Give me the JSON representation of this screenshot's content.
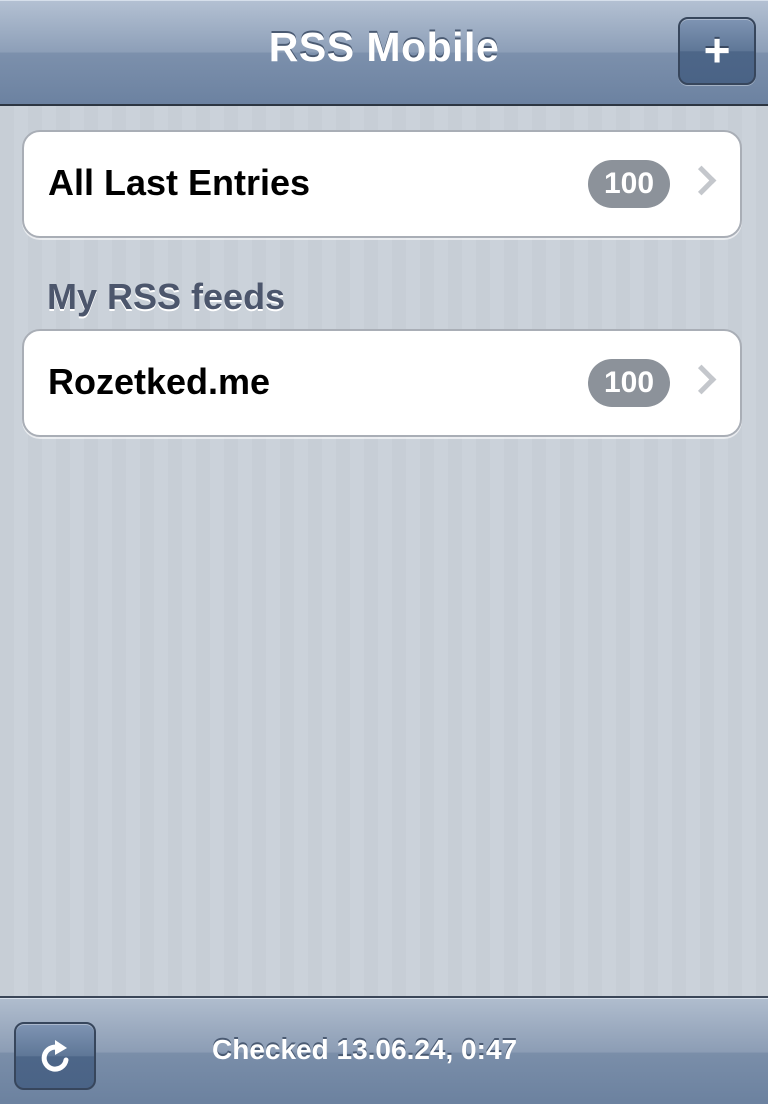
{
  "navbar": {
    "title": "RSS Mobile",
    "add_button_label": "+",
    "add_button_icon": "plus-icon"
  },
  "all_entries": {
    "label": "All Last Entries",
    "count": "100",
    "chevron_icon": "chevron-right-icon"
  },
  "feeds_section": {
    "header": "My RSS feeds",
    "items": [
      {
        "label": "Rozetked.me",
        "count": "100",
        "chevron_icon": "chevron-right-icon"
      }
    ]
  },
  "toolbar": {
    "refresh_icon": "refresh-icon",
    "status": "Checked 13.06.24, 0:47"
  },
  "colors": {
    "navbar": "#7c90ac",
    "background": "#c5ccd4",
    "badge": "#8c929a",
    "section_header": "#4c566c"
  }
}
